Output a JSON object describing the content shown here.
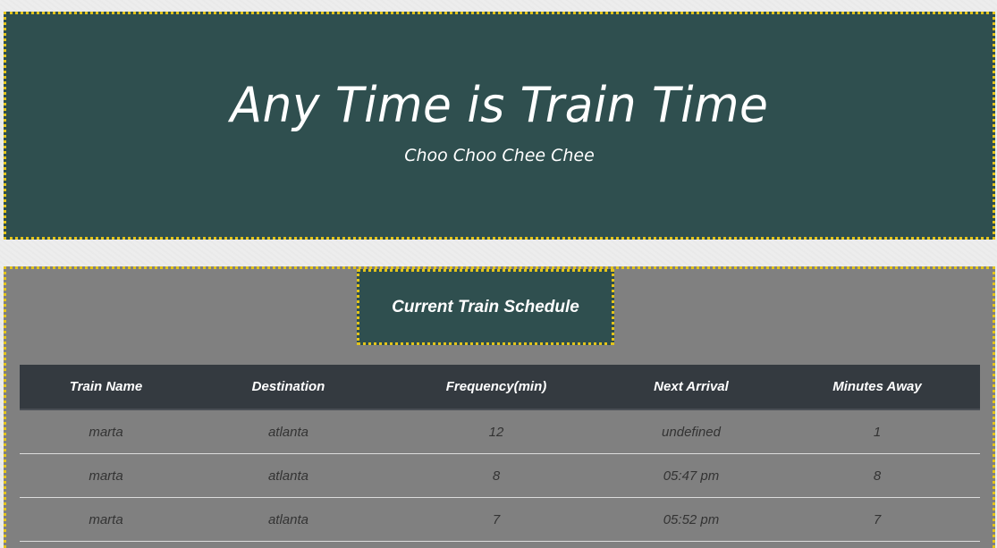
{
  "header": {
    "title": "Any Time is Train Time",
    "tagline": "Choo Choo Chee Chee"
  },
  "schedule": {
    "heading": "Current Train Schedule",
    "columns": [
      "Train Name",
      "Destination",
      "Frequency(min)",
      "Next Arrival",
      "Minutes Away"
    ],
    "rows": [
      [
        "marta",
        "atlanta",
        "12",
        "undefined",
        "1"
      ],
      [
        "marta",
        "atlanta",
        "8",
        "05:47 pm",
        "8"
      ],
      [
        "marta",
        "atlanta",
        "7",
        "05:52 pm",
        "7"
      ]
    ]
  },
  "colors": {
    "panel_dark": "#2f4f4f",
    "panel_gray": "#808080",
    "table_header": "#343a40",
    "dotted_border": "#e3c41a"
  }
}
